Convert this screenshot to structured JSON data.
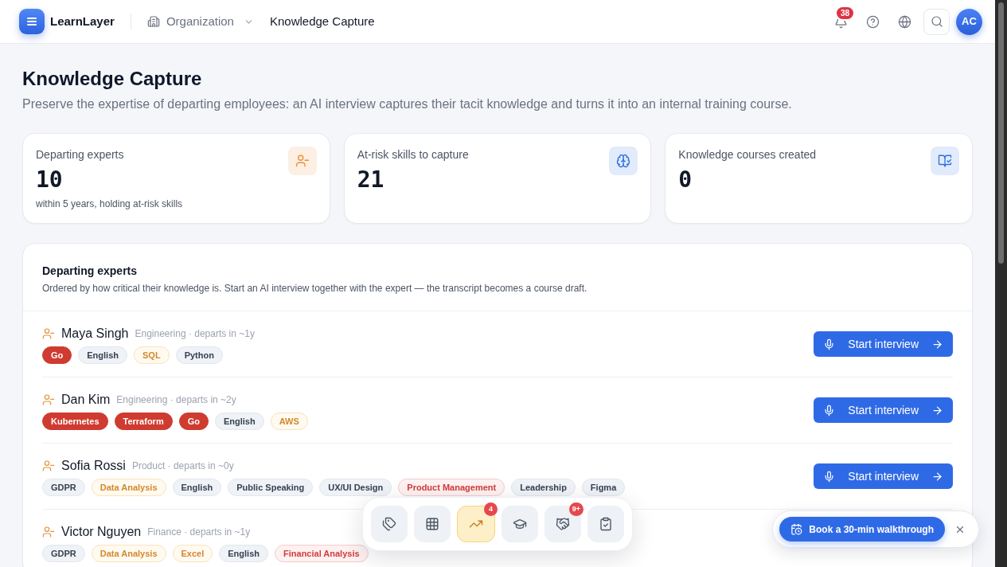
{
  "header": {
    "brand": "LearnLayer",
    "breadcrumbs": [
      {
        "label": "Organization",
        "kind": "dropdown"
      },
      {
        "label": "Knowledge Capture",
        "kind": "current"
      }
    ],
    "notification_count": "38",
    "avatar_initials": "AC"
  },
  "page": {
    "title": "Knowledge Capture",
    "subtitle": "Preserve the expertise of departing employees: an AI interview captures their tacit knowledge and turns it into an internal training course."
  },
  "stats": [
    {
      "label": "Departing experts",
      "value": "10",
      "note": "within 5 years, holding at-risk skills",
      "color": "#e8913a"
    },
    {
      "label": "At-risk skills to capture",
      "value": "21",
      "color": "#2f6fe4"
    },
    {
      "label": "Knowledge courses created",
      "value": "0",
      "color": "#2f6fe4"
    }
  ],
  "experts_panel": {
    "title": "Departing experts",
    "description": "Ordered by how critical their knowledge is. Start an AI interview together with the expert — the transcript becomes a course draft.",
    "experts": [
      {
        "name": "Maya Singh",
        "meta": "Engineering · departs in ~1y",
        "tags": [
          {
            "label": "Go",
            "kind": "critical"
          },
          {
            "label": "English",
            "kind": "low"
          },
          {
            "label": "SQL",
            "kind": "medium"
          },
          {
            "label": "Python",
            "kind": "low"
          }
        ],
        "action": "Start interview"
      },
      {
        "name": "Dan Kim",
        "meta": "Engineering · departs in ~2y",
        "tags": [
          {
            "label": "Kubernetes",
            "kind": "critical"
          },
          {
            "label": "Terraform",
            "kind": "critical"
          },
          {
            "label": "Go",
            "kind": "critical"
          },
          {
            "label": "English",
            "kind": "low"
          },
          {
            "label": "AWS",
            "kind": "medium"
          }
        ],
        "action": "Start interview"
      },
      {
        "name": "Sofia Rossi",
        "meta": "Product · departs in ~0y",
        "tags": [
          {
            "label": "GDPR",
            "kind": "low"
          },
          {
            "label": "Data Analysis",
            "kind": "medium"
          },
          {
            "label": "English",
            "kind": "low"
          },
          {
            "label": "Public Speaking",
            "kind": "low"
          },
          {
            "label": "UX/UI Design",
            "kind": "low"
          },
          {
            "label": "Product Management",
            "kind": "high"
          },
          {
            "label": "Leadership",
            "kind": "low"
          },
          {
            "label": "Figma",
            "kind": "low"
          }
        ],
        "action": "Start interview"
      },
      {
        "name": "Victor Nguyen",
        "meta": "Finance · departs in ~1y",
        "tags": [
          {
            "label": "GDPR",
            "kind": "low"
          },
          {
            "label": "Data Analysis",
            "kind": "medium"
          },
          {
            "label": "Excel",
            "kind": "medium"
          },
          {
            "label": "English",
            "kind": "low"
          },
          {
            "label": "Financial Analysis",
            "kind": "high"
          }
        ]
      }
    ]
  },
  "dock": [
    {
      "selected": false
    },
    {
      "selected": false
    },
    {
      "selected": true,
      "badge": "4"
    },
    {
      "selected": false
    },
    {
      "selected": false,
      "badge": "9+"
    },
    {
      "selected": false
    }
  ],
  "walkthrough_toast": {
    "label": "Book a 30-min walkthrough"
  }
}
